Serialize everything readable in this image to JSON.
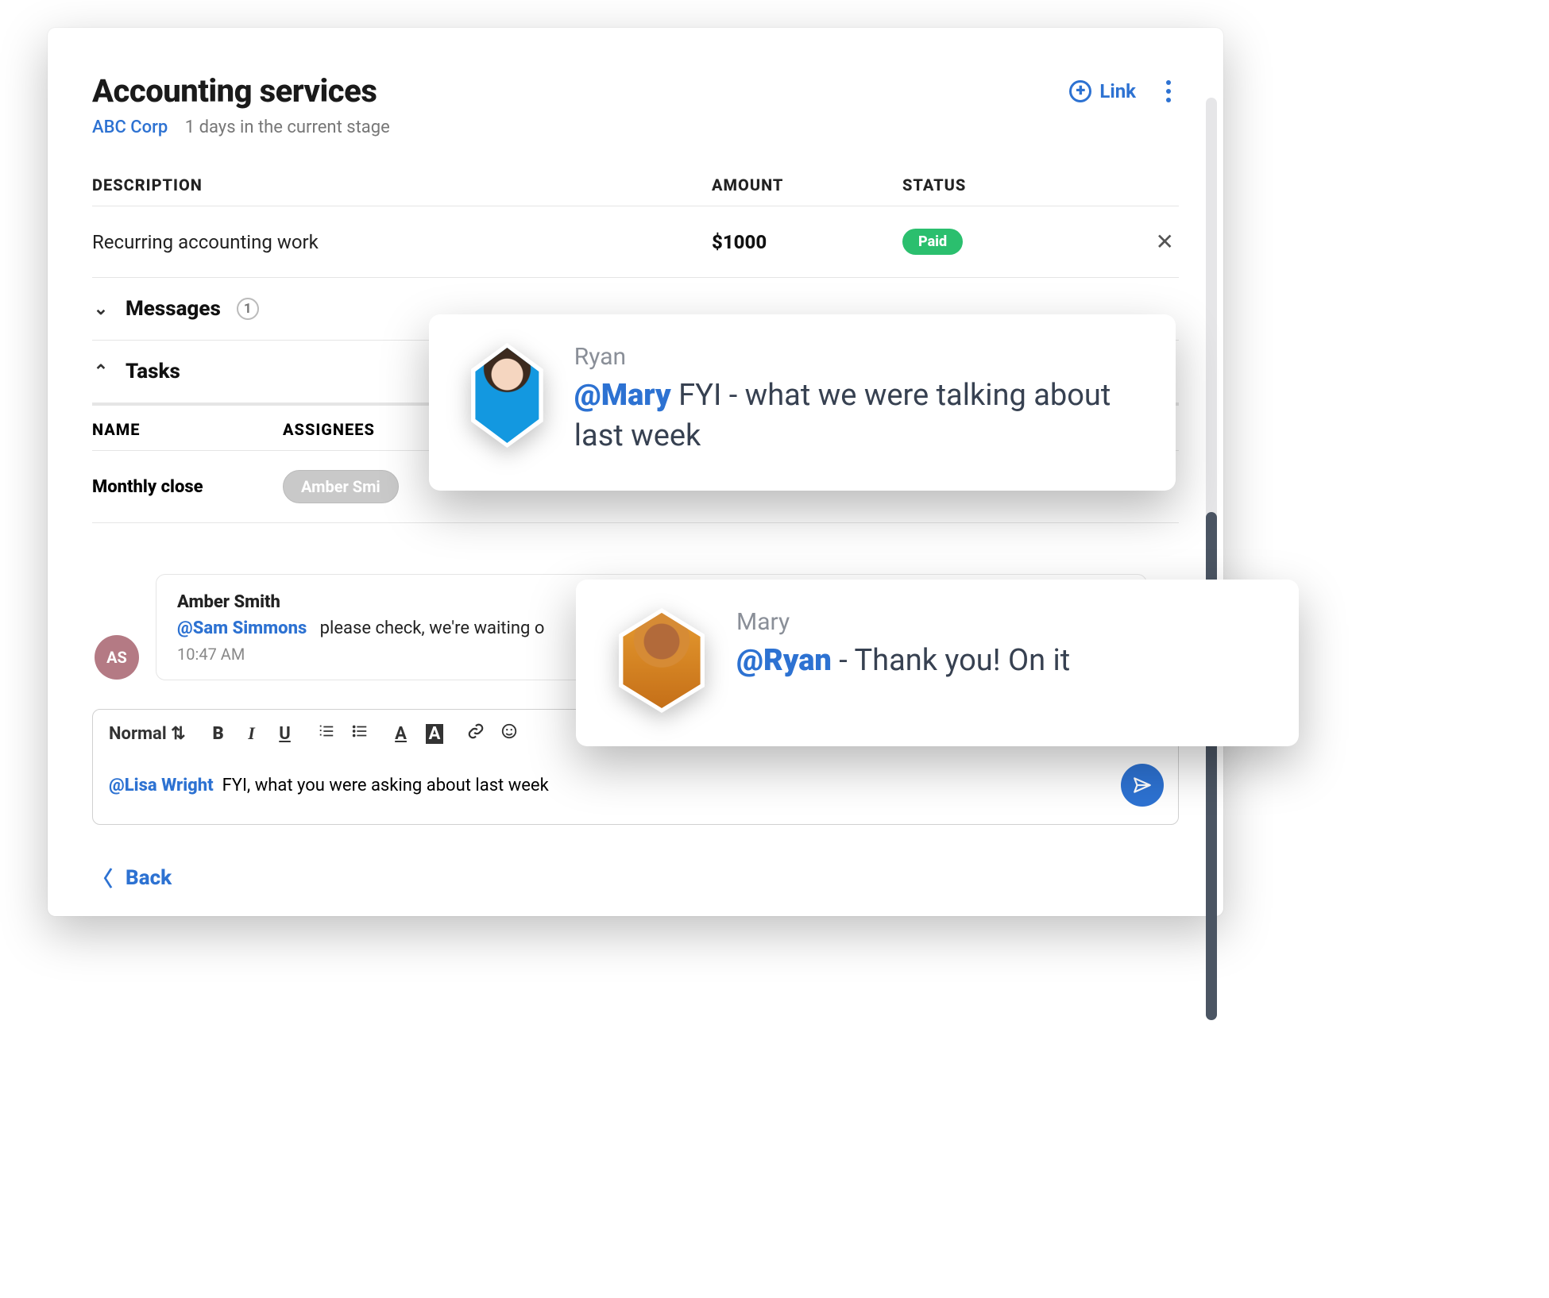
{
  "header": {
    "title": "Accounting services",
    "company": "ABC Corp",
    "stage_text": "1 days in the current stage",
    "link_label": "Link"
  },
  "columns": {
    "description": "DESCRIPTION",
    "amount": "AMOUNT",
    "status": "STATUS"
  },
  "line_item": {
    "description": "Recurring accounting work",
    "amount": "$1000",
    "status": "Paid"
  },
  "sections": {
    "messages_label": "Messages",
    "messages_count": "1",
    "tasks_label": "Tasks"
  },
  "task_columns": {
    "name": "NAME",
    "assignees": "ASSIGNEES"
  },
  "task": {
    "name": "Monthly close",
    "assignee_chip": "Amber Smi"
  },
  "message": {
    "author": "Amber Smith",
    "mention": "@Sam Simmons",
    "body": "please check, we're waiting o",
    "time": "10:47 AM",
    "avatar_initials": "AS"
  },
  "compose": {
    "style_label": "Normal",
    "mention": "@Lisa Wright",
    "body": "FYI, what you were asking about last week"
  },
  "back_label": "Back",
  "bubble1": {
    "from": "Ryan",
    "mention": "@Mary",
    "text": " FYI - what we were talking about last week"
  },
  "bubble2": {
    "from": "Mary",
    "mention": "@Ryan",
    "text": " - Thank you! On it"
  }
}
